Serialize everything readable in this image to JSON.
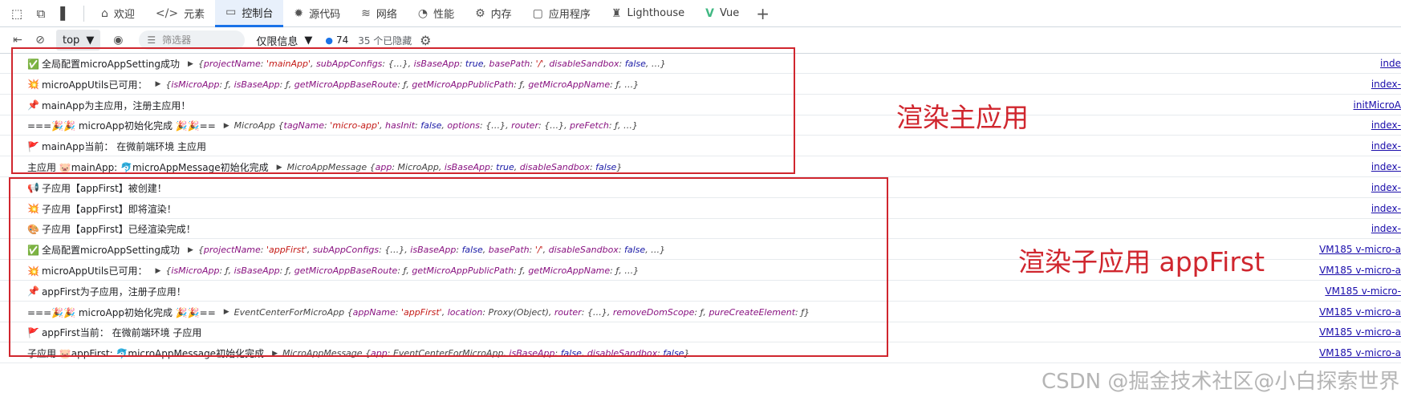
{
  "tabbar": {
    "tabs": [
      {
        "label": "欢迎",
        "icon": "home-icon",
        "glyph": "⌂",
        "active": false
      },
      {
        "label": "元素",
        "icon": "code-icon",
        "glyph": "</>",
        "active": false
      },
      {
        "label": "控制台",
        "icon": "console-icon",
        "glyph": "▭",
        "active": true
      },
      {
        "label": "源代码",
        "icon": "bug-icon",
        "glyph": "✹",
        "active": false
      },
      {
        "label": "网络",
        "icon": "wifi-icon",
        "glyph": "≋",
        "active": false
      },
      {
        "label": "性能",
        "icon": "performance-icon",
        "glyph": "◔",
        "active": false
      },
      {
        "label": "内存",
        "icon": "memory-icon",
        "glyph": "⚙",
        "active": false
      },
      {
        "label": "应用程序",
        "icon": "application-icon",
        "glyph": "▢",
        "active": false
      },
      {
        "label": "Lighthouse",
        "icon": "lighthouse-icon",
        "glyph": "♜",
        "active": false
      },
      {
        "label": "Vue",
        "icon": "vue-icon",
        "glyph": "V",
        "active": false
      }
    ]
  },
  "toolbar": {
    "context": "top",
    "filter_placeholder": "筛选器",
    "levels": "仅限信息",
    "issues_count": "74",
    "hidden": "35 个已隐藏"
  },
  "console": {
    "rows": [
      {
        "emoji": "✅",
        "text": "全局配置microAppSetting成功",
        "expand": true,
        "obj": "{projectName: 'mainApp', subAppConfigs: {…}, isBaseApp: true, basePath: '/', disableSandbox: false, …}",
        "source": "inde"
      },
      {
        "emoji": "💥",
        "text": "microAppUtils已可用：",
        "expand": true,
        "obj": "{isMicroApp: ƒ, isBaseApp: ƒ, getMicroAppBaseRoute: ƒ, getMicroAppPublicPath: ƒ, getMicroAppName: ƒ, …}",
        "source": "index-"
      },
      {
        "emoji": "📌",
        "text": "mainApp为主应用，注册主应用！",
        "expand": false,
        "obj": "",
        "source": "initMicroA"
      },
      {
        "emoji": "",
        "text": "===🎉🎉 microApp初始化完成 🎉🎉==",
        "expand": true,
        "obj": "MicroApp {tagName: 'micro-app', hasInit: false, options: {…}, router: {…}, preFetch: ƒ, …}",
        "source": "index-"
      },
      {
        "emoji": "🚩",
        "text": "mainApp当前： 在微前端环境 主应用",
        "expand": false,
        "obj": "",
        "source": "index-"
      },
      {
        "emoji": "",
        "text": "主应用 🐷mainApp: 🐬microAppMessage初始化完成",
        "expand": true,
        "obj": "MicroAppMessage {app: MicroApp, isBaseApp: true, disableSandbox: false}",
        "source": "index-"
      },
      {
        "emoji": "📢",
        "text": "子应用【appFirst】被创建！",
        "expand": false,
        "obj": "",
        "source": "index-"
      },
      {
        "emoji": "💥",
        "text": "子应用【appFirst】即将渲染！",
        "expand": false,
        "obj": "",
        "source": "index-"
      },
      {
        "emoji": "🎨",
        "text": "子应用【appFirst】已经渲染完成！",
        "expand": false,
        "obj": "",
        "source": "index-"
      },
      {
        "emoji": "✅",
        "text": "全局配置microAppSetting成功",
        "expand": true,
        "obj": "{projectName: 'appFirst', subAppConfigs: {…}, isBaseApp: false, basePath: '/', disableSandbox: false, …}",
        "source": "VM185 v-micro-a"
      },
      {
        "emoji": "💥",
        "text": "microAppUtils已可用：",
        "expand": true,
        "obj": "{isMicroApp: ƒ, isBaseApp: ƒ, getMicroAppBaseRoute: ƒ, getMicroAppPublicPath: ƒ, getMicroAppName: ƒ, …}",
        "source": "VM185 v-micro-a"
      },
      {
        "emoji": "📌",
        "text": "appFirst为子应用，注册子应用！",
        "expand": false,
        "obj": "",
        "source": "VM185 v-micro-"
      },
      {
        "emoji": "",
        "text": "===🎉🎉 microApp初始化完成 🎉🎉==",
        "expand": true,
        "obj": "EventCenterForMicroApp {appName: 'appFirst', location: Proxy(Object), router: {…}, removeDomScope: ƒ, pureCreateElement: ƒ}",
        "source": "VM185 v-micro-a"
      },
      {
        "emoji": "🚩",
        "text": "appFirst当前： 在微前端环境 子应用",
        "expand": false,
        "obj": "",
        "source": "VM185 v-micro-a"
      },
      {
        "emoji": "",
        "text": "子应用 🐷appFirst: 🐬microAppMessage初始化完成",
        "expand": true,
        "obj": "MicroAppMessage {app: EventCenterForMicroApp, isBaseApp: false, disableSandbox: false}",
        "source": "VM185 v-micro-a"
      }
    ]
  },
  "annotations": {
    "main": "渲染主应用",
    "sub": "渲染子应用 appFirst"
  },
  "watermark": "CSDN @掘金技术社区@小白探索世界欧耶"
}
